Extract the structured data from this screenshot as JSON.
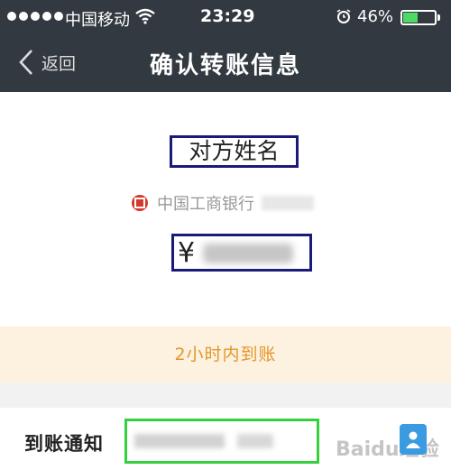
{
  "status_bar": {
    "carrier": "中国移动",
    "time": "23:29",
    "battery_percent": "46%",
    "battery_level": 0.46,
    "signal_bars_filled": 5,
    "icons": [
      "signal-dots-icon",
      "wifi-icon",
      "alarm-icon",
      "battery-icon"
    ]
  },
  "nav": {
    "back_label": "返回",
    "title": "确认转账信息"
  },
  "recipient": {
    "name_label": "对方姓名",
    "bank_name": "中国工商银行",
    "bank_logo_color": "#d33a2c",
    "currency_symbol": "¥"
  },
  "arrival_notice": "2小时内到账",
  "notification": {
    "label": "到账通知"
  },
  "watermark": "Baidu经验",
  "colors": {
    "nav_bg": "#333940",
    "arrival_bg": "#fcf2df",
    "arrival_text": "#e4962b",
    "annotation_blue": "#1a1a7a",
    "annotation_green": "#36d03c",
    "contact_btn": "#3b9be0"
  }
}
